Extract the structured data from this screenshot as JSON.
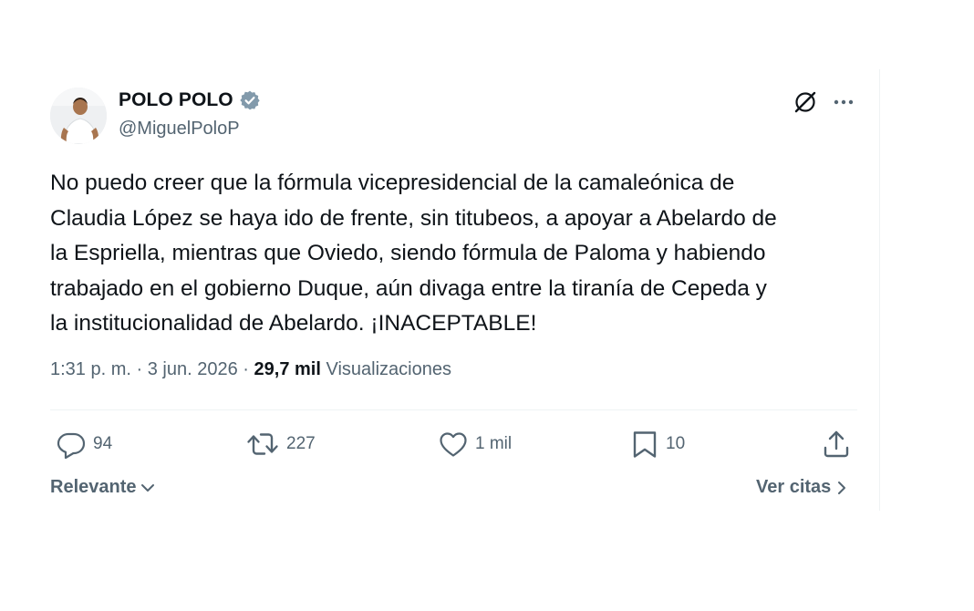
{
  "tweet": {
    "author": {
      "display_name": "POLO POLO",
      "handle": "@MiguelPoloP",
      "verified": true,
      "verified_color": "#829aab"
    },
    "text": "No puedo creer que la fórmula vicepresidencial de la camaleónica de\nClaudia López se haya ido de frente, sin titubeos, a apoyar a Abelardo de\nla Espriella, mientras que Oviedo, siendo fórmula de Paloma y habiendo\ntrabajado en el gobierno Duque, aún divaga entre la tiranía de Cepeda y\nla institucionalidad de Abelardo. ¡INACEPTABLE!",
    "meta": {
      "time": "1:31 p. m.",
      "separator": "·",
      "date": "3 jun. 2026",
      "views_count": "29,7 mil",
      "views_label": "Visualizaciones"
    },
    "actions": {
      "replies": "94",
      "reposts": "227",
      "likes": "1 mil",
      "bookmarks": "10"
    },
    "footer": {
      "sort_label": "Relevante",
      "quotes_label": "Ver citas"
    }
  },
  "icons": {
    "top_right": [
      "grok-icon",
      "more-icon"
    ],
    "actions": [
      "reply-icon",
      "repost-icon",
      "like-icon",
      "bookmark-icon",
      "share-icon"
    ]
  },
  "colors": {
    "text": "#0f1419",
    "secondary": "#536471",
    "border": "#eff3f4"
  }
}
